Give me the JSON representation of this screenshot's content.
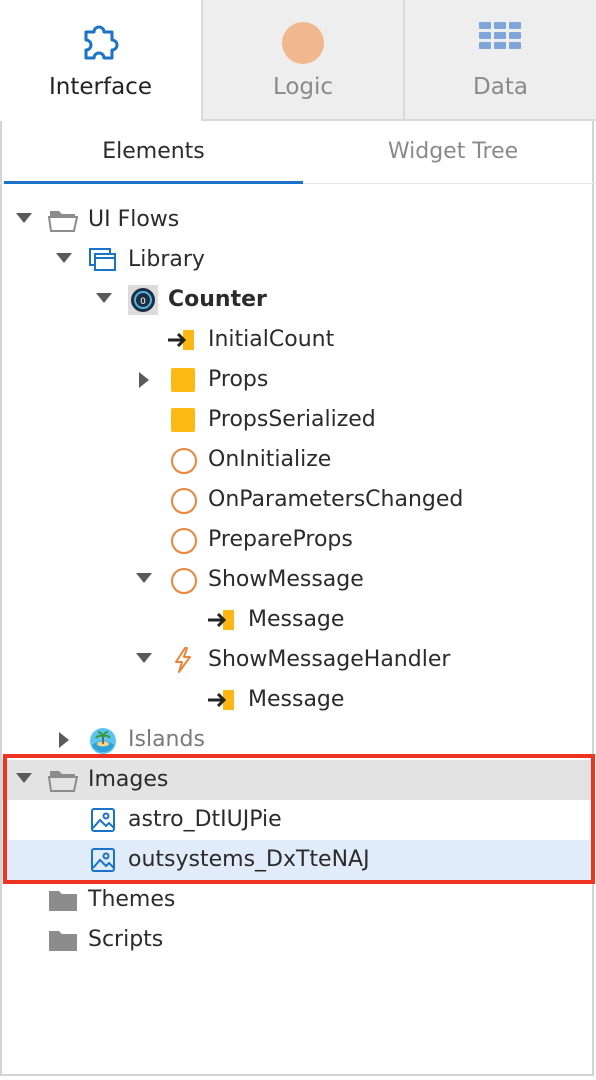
{
  "top_tabs": [
    {
      "label": "Interface",
      "icon": "puzzle-icon",
      "active": true
    },
    {
      "label": "Logic",
      "icon": "logic-circle-icon",
      "active": false
    },
    {
      "label": "Data",
      "icon": "grid-icon",
      "active": false
    }
  ],
  "sub_tabs": [
    {
      "label": "Elements",
      "active": true
    },
    {
      "label": "Widget Tree",
      "active": false
    }
  ],
  "tree": {
    "ui_flows": "UI Flows",
    "library": "Library",
    "counter": "Counter",
    "initial_count": "InitialCount",
    "props": "Props",
    "props_serialized": "PropsSerialized",
    "on_initialize": "OnInitialize",
    "on_parameters_changed": "OnParametersChanged",
    "prepare_props": "PrepareProps",
    "show_message": "ShowMessage",
    "show_message_param": "Message",
    "show_message_handler": "ShowMessageHandler",
    "show_message_handler_param": "Message",
    "islands": "Islands",
    "images": "Images",
    "image_1": "astro_DtIUJPie",
    "image_2": "outsystems_DxTteNAJ",
    "themes": "Themes",
    "scripts": "Scripts"
  },
  "colors": {
    "accent_blue": "#1a73c9",
    "highlight_red": "#ee3322",
    "parameter_yellow": "#fdb813",
    "action_orange": "#e8853c",
    "selected_blue": "#e0ecf9",
    "selected_gray": "#e3e3e3"
  }
}
